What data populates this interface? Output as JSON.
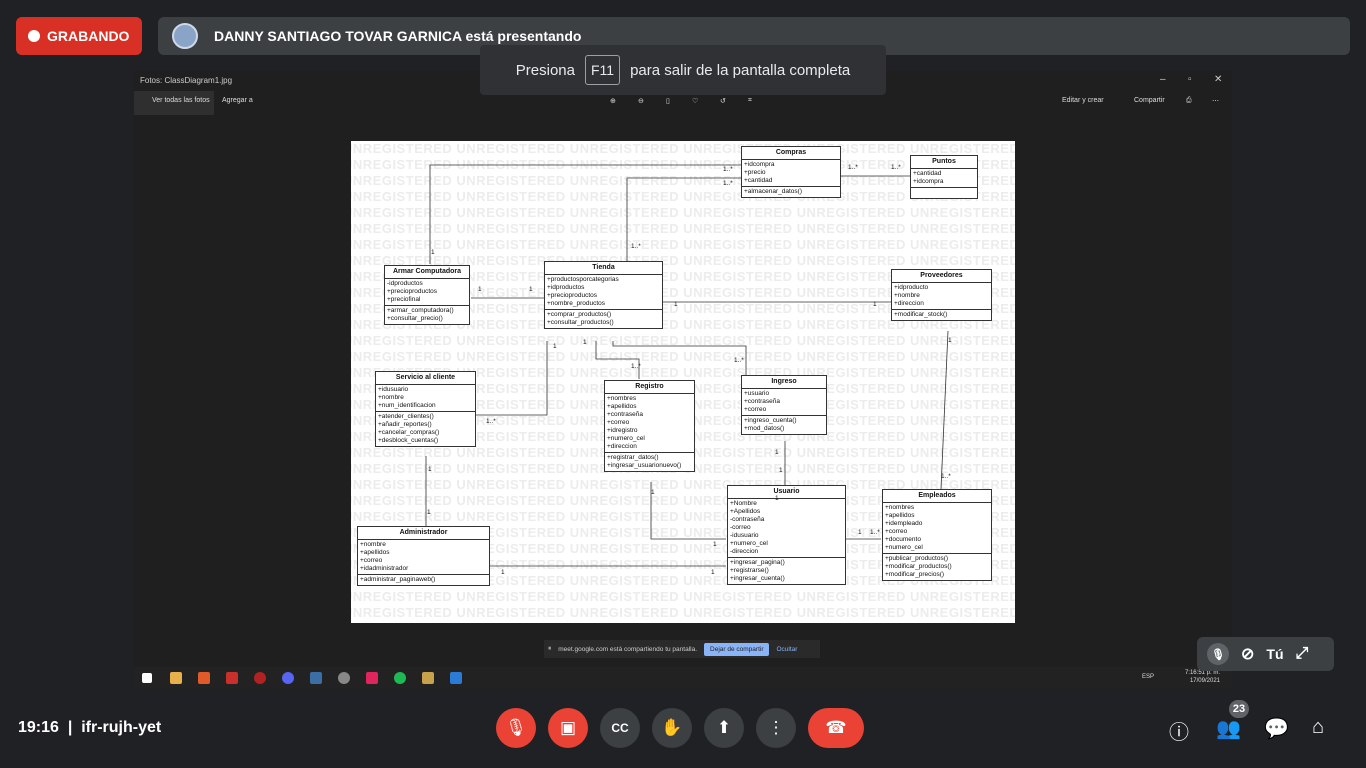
{
  "meet": {
    "recording_label": "GRABANDO",
    "presenter_text": "DANNY SANTIAGO TOVAR GARNICA está presentando",
    "toast_pre": "Presiona",
    "toast_key": "F11",
    "toast_post": "para salir de la pantalla completa",
    "self_label": "Tú",
    "time": "19:16",
    "meeting_code": "ifr-rujh-yet",
    "participants": "23"
  },
  "photos": {
    "title": "Fotos: ClassDiagram1.jpg",
    "view_all": "Ver todas las fotos",
    "add_to": "Agregar a",
    "edit": "Editar y crear",
    "share": "Compartir"
  },
  "diagram": {
    "watermark": "UNREGISTERED UNREGISTERED UNREGISTERED UNREGISTERED UNREGISTERED UNREGISTERED",
    "classes": [
      {
        "name": "Compras",
        "attrs": [
          "+idcompra",
          "+precio",
          "+cantidad"
        ],
        "ops": [
          "+almacenar_datos()"
        ]
      },
      {
        "name": "Puntos",
        "attrs": [
          "+cantidad",
          "+idcompra"
        ],
        "ops": []
      },
      {
        "name": "Armar Computadora",
        "attrs": [
          "-idproductos",
          "+precioproductos",
          "+preciofinal"
        ],
        "ops": [
          "+armar_computadora()",
          "+consultar_precio()"
        ]
      },
      {
        "name": "Tienda",
        "attrs": [
          "+productosporcategorias",
          "+idproductos",
          "+precioproductos",
          "+nombre_productos"
        ],
        "ops": [
          "+comprar_productos()",
          "+consultar_productos()"
        ]
      },
      {
        "name": "Proveedores",
        "attrs": [
          "+idproducto",
          "+nombre",
          "+direccion"
        ],
        "ops": [
          "+modificar_stock()"
        ]
      },
      {
        "name": "Servicio al cliente",
        "attrs": [
          "+idusuario",
          "+nombre",
          "+num_identificacion"
        ],
        "ops": [
          "+atender_clientes()",
          "+añadir_reportes()",
          "+cancelar_compras()",
          "+desblock_cuentas()"
        ]
      },
      {
        "name": "Registro",
        "attrs": [
          "+nombres",
          "+apellidos",
          "+contraseña",
          "+correo",
          "+idregistro",
          "+numero_cel",
          "+direccion"
        ],
        "ops": [
          "+registrar_datos()",
          "+ingresar_usuarionuevo()"
        ]
      },
      {
        "name": "Ingreso",
        "attrs": [
          "+usuario",
          "+contraseña",
          "+correo"
        ],
        "ops": [
          "+ingreso_cuenta()",
          "+mod_datos()"
        ]
      },
      {
        "name": "Administrador",
        "attrs": [
          "+nombre",
          "+apellidos",
          "+correo",
          "+idadministrador"
        ],
        "ops": [
          "+administrar_paginaweb()"
        ]
      },
      {
        "name": "Usuario",
        "attrs": [
          "+Nombre",
          "+Apellidos",
          "-contraseña",
          "-correo",
          "-idusuario",
          "+numero_cel",
          "-direccion"
        ],
        "ops": [
          "+ingresar_pagina()",
          "+registrarse()",
          "+ingresar_cuenta()"
        ]
      },
      {
        "name": "Empleados",
        "attrs": [
          "+nombres",
          "+apellidos",
          "+idempleado",
          "+correo",
          "+documento",
          "+numero_cel"
        ],
        "ops": [
          "+publicar_productos()",
          "+modificar_productos()",
          "+modificar_precios()"
        ]
      }
    ],
    "multiplicities": [
      "1..*",
      "1..*",
      "1..*",
      "1..*",
      "1",
      "1..*",
      "1",
      "1",
      "1",
      "1",
      "1",
      "1..*",
      "1..*",
      "1",
      "1..*",
      "1",
      "1",
      "1",
      "1",
      "1",
      "1",
      "1",
      "1",
      "1..*",
      "1",
      "1",
      "1..*",
      "1"
    ]
  },
  "share_bar": {
    "text": "meet.google.com está compartiendo tu pantalla.",
    "stop": "Dejar de compartir",
    "hide": "Ocultar"
  },
  "taskbar": {
    "time": "7:16:51 p. m.",
    "date": "17/09/2021",
    "lang": "ESP"
  },
  "colors": {
    "recording": "#d93025",
    "end_call": "#ea4335",
    "panel": "#3c4043"
  }
}
